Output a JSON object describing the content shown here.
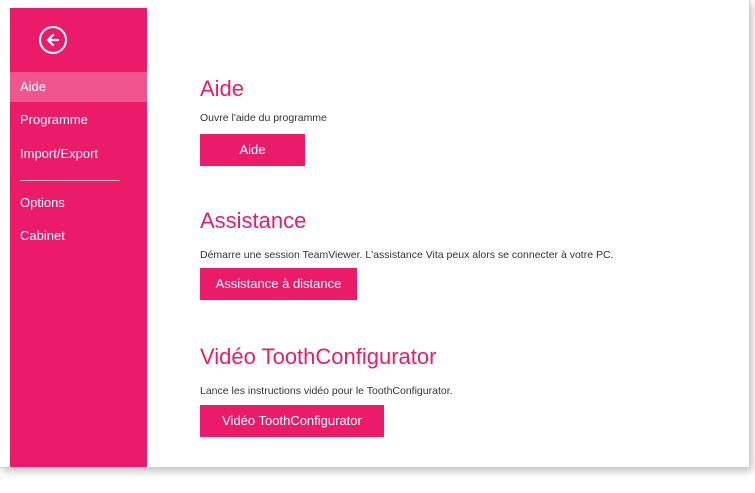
{
  "sidebar": {
    "back_icon": "arrow-left-circle-icon",
    "items": [
      {
        "label": "Aide",
        "active": true
      },
      {
        "label": "Programme",
        "active": false
      },
      {
        "label": "Import/Export",
        "active": false
      },
      {
        "label": "Options",
        "active": false
      },
      {
        "label": "Cabinet",
        "active": false
      }
    ]
  },
  "main": {
    "sections": [
      {
        "title": "Aide",
        "description": "Ouvre l'aide du programme",
        "button_label": "Aide"
      },
      {
        "title": "Assistance",
        "description": "Démarre une session TeamViewer. L'assistance Vita peux alors se connecter à votre PC.",
        "button_label": "Assistance à distance"
      },
      {
        "title": "Vidéo ToothConfigurator",
        "description": "Lance les instructions vidéo pour le ToothConfigurator.",
        "button_label": "Vidéo ToothConfigurator"
      }
    ]
  },
  "colors": {
    "accent": "#ec1b69",
    "active_item": "#f0558f",
    "text": "#333333"
  }
}
